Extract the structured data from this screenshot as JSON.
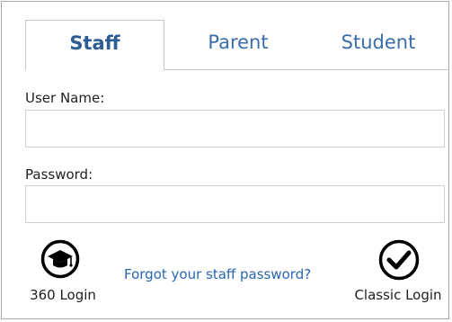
{
  "tabs": [
    {
      "label": "Staff",
      "selected": true
    },
    {
      "label": "Parent",
      "selected": false
    },
    {
      "label": "Student",
      "selected": false
    }
  ],
  "form": {
    "username_label": "User Name:",
    "username_value": "",
    "password_label": "Password:",
    "password_value": ""
  },
  "actions": {
    "login_360_label": "360 Login",
    "login_360_icon": "graduation-cap-icon",
    "forgot_password_link": "Forgot your staff password?",
    "classic_login_label": "Classic Login",
    "classic_login_icon": "checkmark-circle-icon"
  },
  "colors": {
    "tab_text": "#3a6daa",
    "link": "#2a67b1",
    "border": "#c7c7c7"
  }
}
